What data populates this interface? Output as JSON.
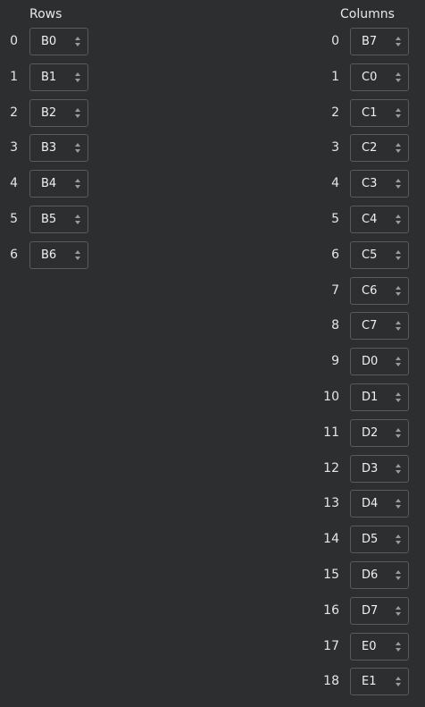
{
  "rows": {
    "heading": "Rows",
    "items": [
      {
        "index": "0",
        "value": "B0"
      },
      {
        "index": "1",
        "value": "B1"
      },
      {
        "index": "2",
        "value": "B2"
      },
      {
        "index": "3",
        "value": "B3"
      },
      {
        "index": "4",
        "value": "B4"
      },
      {
        "index": "5",
        "value": "B5"
      },
      {
        "index": "6",
        "value": "B6"
      }
    ]
  },
  "columns": {
    "heading": "Columns",
    "items": [
      {
        "index": "0",
        "value": "B7"
      },
      {
        "index": "1",
        "value": "C0"
      },
      {
        "index": "2",
        "value": "C1"
      },
      {
        "index": "3",
        "value": "C2"
      },
      {
        "index": "4",
        "value": "C3"
      },
      {
        "index": "5",
        "value": "C4"
      },
      {
        "index": "6",
        "value": "C5"
      },
      {
        "index": "7",
        "value": "C6"
      },
      {
        "index": "8",
        "value": "C7"
      },
      {
        "index": "9",
        "value": "D0"
      },
      {
        "index": "10",
        "value": "D1"
      },
      {
        "index": "11",
        "value": "D2"
      },
      {
        "index": "12",
        "value": "D3"
      },
      {
        "index": "13",
        "value": "D4"
      },
      {
        "index": "14",
        "value": "D5"
      },
      {
        "index": "15",
        "value": "D6"
      },
      {
        "index": "16",
        "value": "D7"
      },
      {
        "index": "17",
        "value": "E0"
      },
      {
        "index": "18",
        "value": "E1"
      }
    ]
  },
  "icons": {
    "spinner": "up-down-arrows-icon"
  },
  "colors": {
    "background": "#2d2e30",
    "border": "#585a5e",
    "text": "#e4e4e4",
    "arrow": "#9a9b9e"
  }
}
